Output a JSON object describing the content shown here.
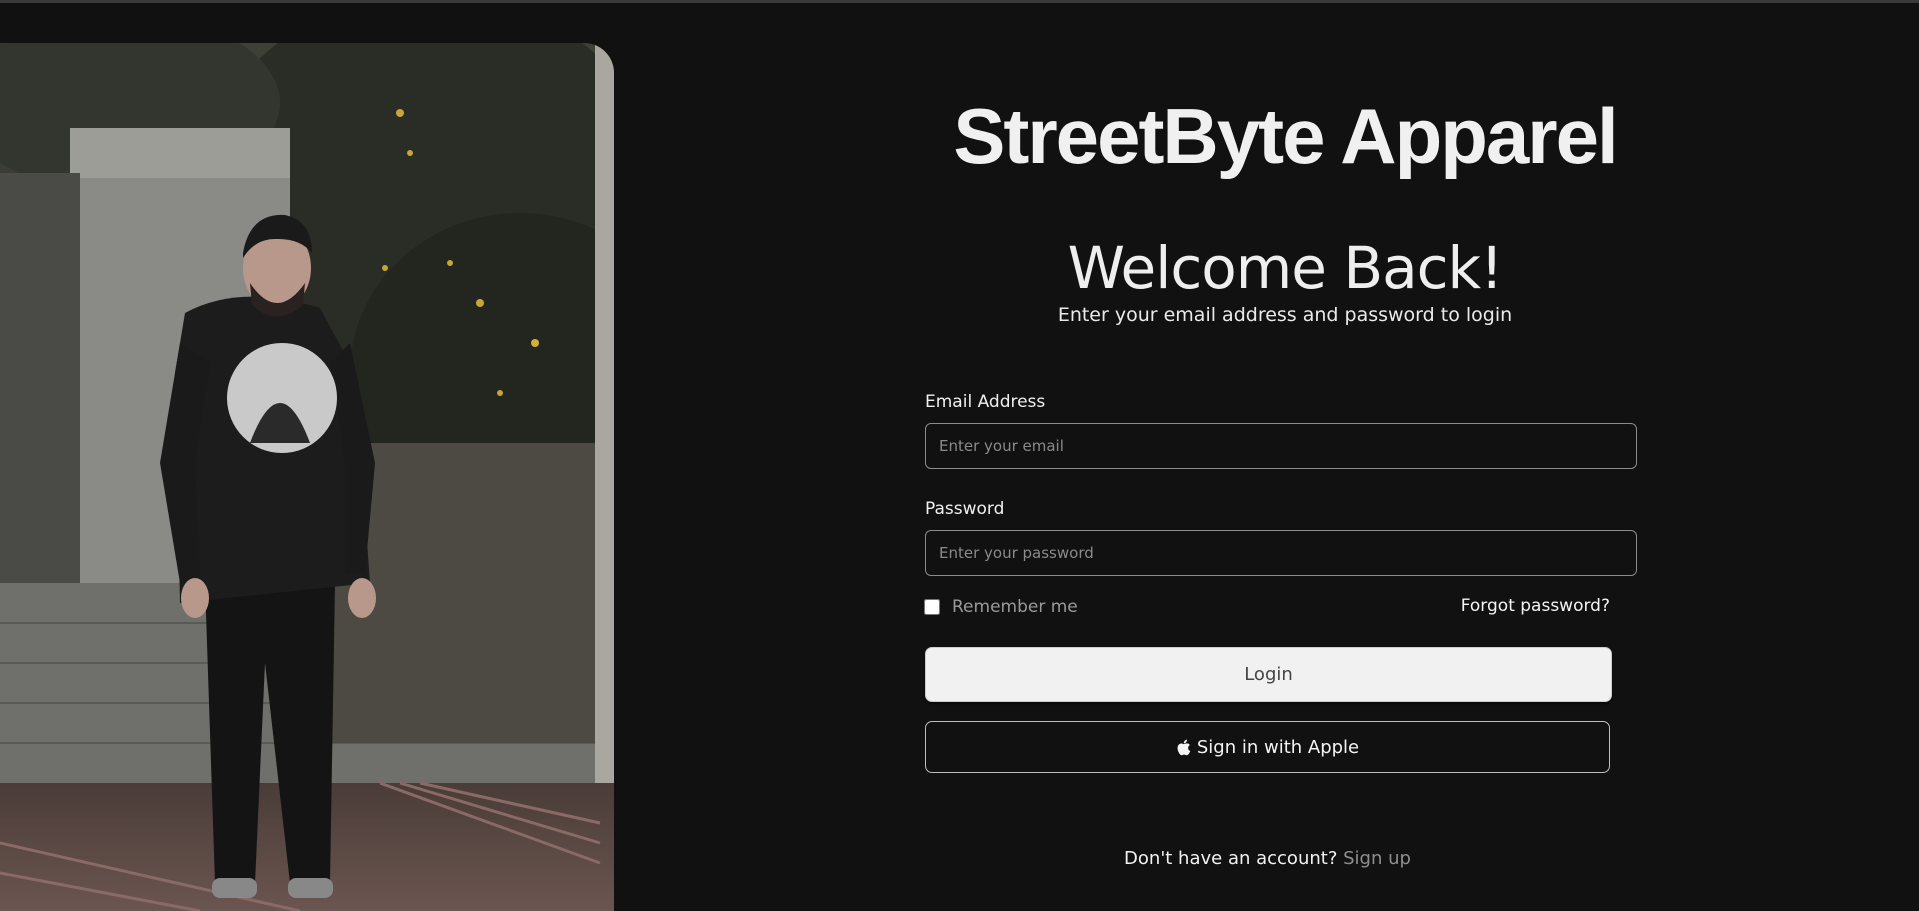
{
  "brand": {
    "name": "StreetByte Apparel"
  },
  "hero": {
    "title": "Welcome Back!",
    "subtitle": "Enter your email address and password to login"
  },
  "form": {
    "email": {
      "label": "Email Address",
      "placeholder": "Enter your email",
      "value": ""
    },
    "password": {
      "label": "Password",
      "placeholder": "Enter your password",
      "value": ""
    },
    "remember_label": "Remember me",
    "remember_checked": false,
    "forgot_label": "Forgot password?",
    "login_label": "Login",
    "apple_label": "Sign in with Apple"
  },
  "signup": {
    "prompt": "Don't have an account?",
    "link": "Sign up"
  },
  "icons": {
    "apple": "apple-icon"
  },
  "colors": {
    "background": "#111111",
    "login_button": "#f1f1f1",
    "muted_link": "#8f8f8f"
  }
}
